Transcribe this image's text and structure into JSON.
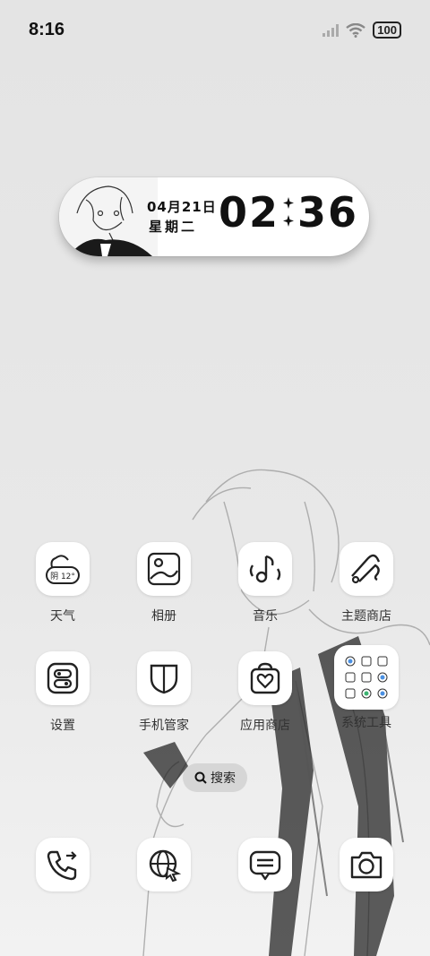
{
  "status_bar": {
    "time": "8:16",
    "battery": "100"
  },
  "widget": {
    "date": "04月21日",
    "weekday": "星期二",
    "hours": "02",
    "minutes": "36"
  },
  "weather_icon_text": "阴 12°",
  "apps_row1": [
    {
      "label": "天气",
      "icon": "weather-icon"
    },
    {
      "label": "相册",
      "icon": "gallery-icon"
    },
    {
      "label": "音乐",
      "icon": "music-icon"
    },
    {
      "label": "主题商店",
      "icon": "theme-store-icon"
    }
  ],
  "apps_row2": [
    {
      "label": "设置",
      "icon": "settings-icon"
    },
    {
      "label": "手机管家",
      "icon": "shield-icon"
    },
    {
      "label": "应用商店",
      "icon": "app-store-icon"
    },
    {
      "label": "系统工具",
      "icon": "folder-icon"
    }
  ],
  "search": {
    "label": "搜索"
  },
  "dock": [
    {
      "icon": "phone-icon"
    },
    {
      "icon": "browser-icon"
    },
    {
      "icon": "messages-icon"
    },
    {
      "icon": "camera-icon"
    }
  ]
}
